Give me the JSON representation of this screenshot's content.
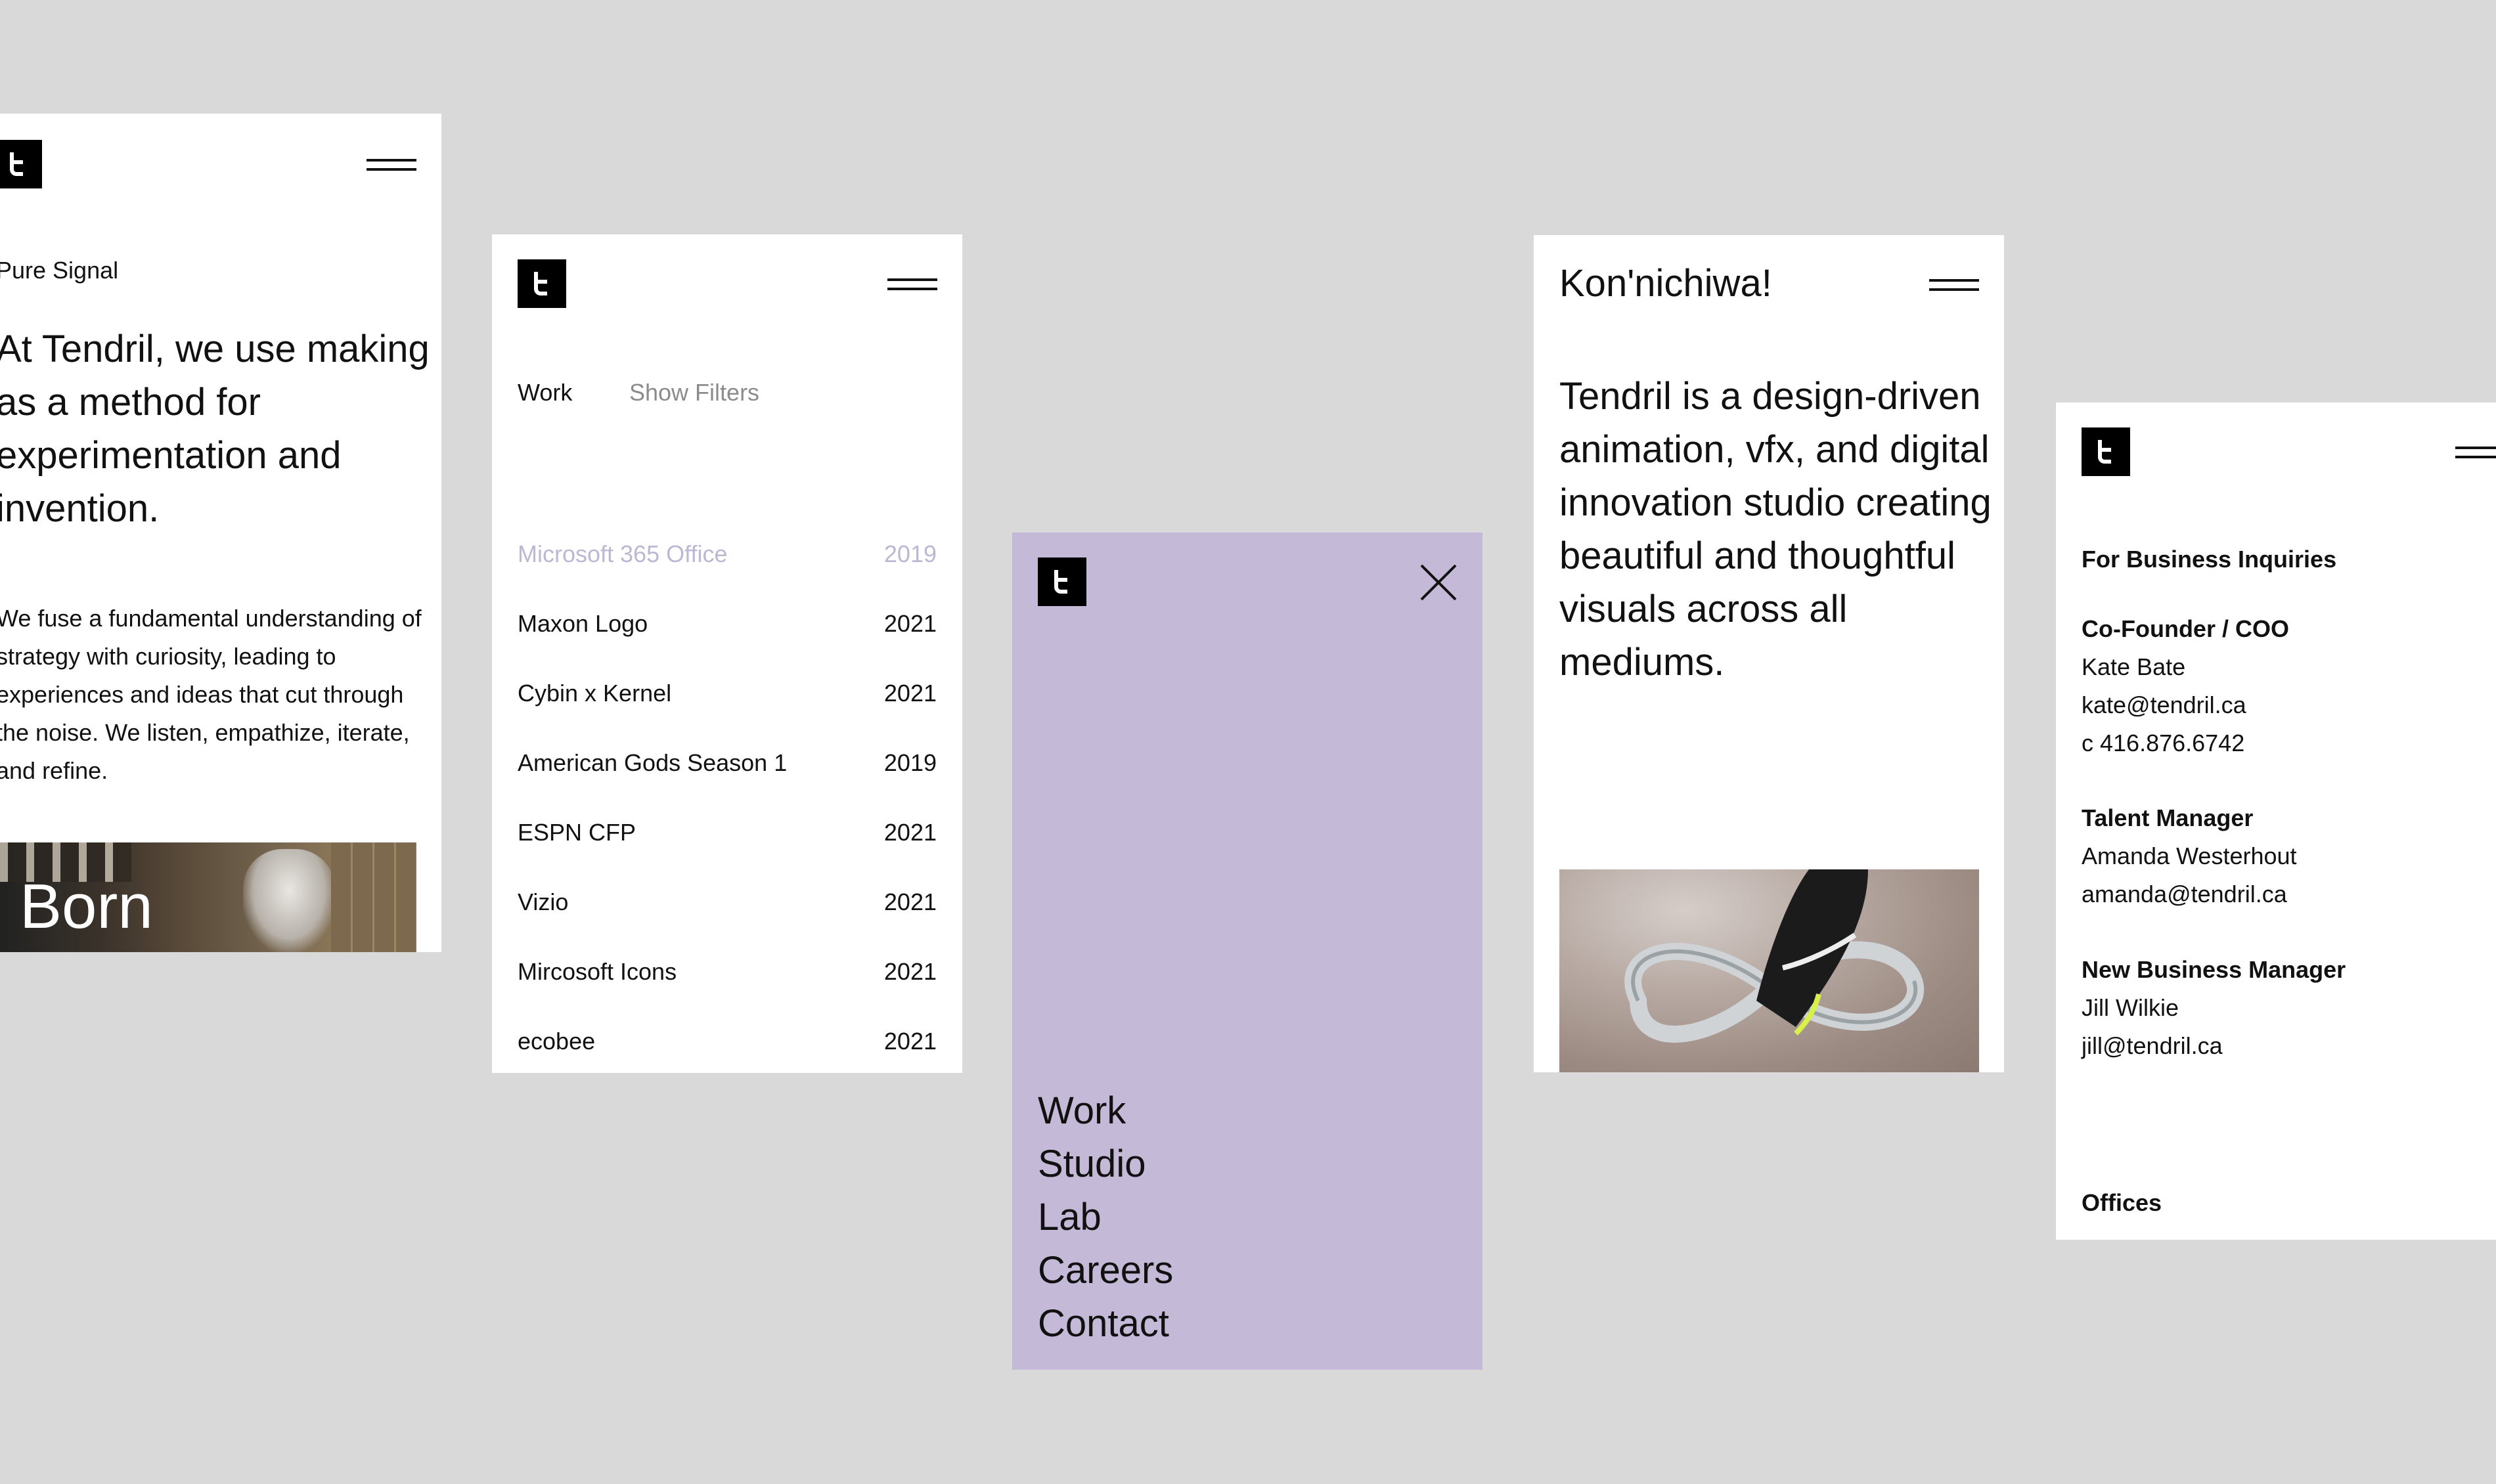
{
  "colors": {
    "canvas": "#d9d9d9",
    "card": "#ffffff",
    "menu_bg": "#c4b9d6",
    "text": "#111111",
    "muted": "#8c8c8c",
    "faded_row": "#bdb7d4"
  },
  "icons": [
    "logo-mark-icon",
    "hamburger-menu-icon",
    "close-icon"
  ],
  "about_card": {
    "eyebrow": "Pure Signal",
    "headline": "At Tendril, we use making as a method for experimentation and invention.",
    "body": "We fuse a fundamental understanding of strategy with curiosity, leading to experiences and ideas that cut through the noise. We listen, empathize, iterate, and refine.",
    "photo_caption": "Born"
  },
  "work_card": {
    "tab_active": "Work",
    "tab_filters": "Show Filters",
    "items": [
      {
        "name": "Microsoft 365 Office",
        "year": "2019"
      },
      {
        "name": "Maxon Logo",
        "year": "2021"
      },
      {
        "name": "Cybin x Kernel",
        "year": "2021"
      },
      {
        "name": "American Gods Season 1",
        "year": "2019"
      },
      {
        "name": "ESPN CFP",
        "year": "2021"
      },
      {
        "name": "Vizio",
        "year": "2021"
      },
      {
        "name": "Mircosoft Icons",
        "year": "2021"
      },
      {
        "name": "ecobee",
        "year": "2021"
      }
    ]
  },
  "menu_card": {
    "nav": [
      "Work",
      "Studio",
      "Lab",
      "Careers",
      "Contact"
    ]
  },
  "hello_card": {
    "greeting": "Kon'nichiwa!",
    "lede": "Tendril is a design-driven animation, vfx, and digital innovation studio creating beautiful and thoughtful visuals across all mediums."
  },
  "contact_card": {
    "heading": "For Business Inquiries",
    "contacts": [
      {
        "role": "Co-Founder / COO",
        "name": "Kate Bate",
        "email": "kate@tendril.ca",
        "phone": "c 416.876.6742"
      },
      {
        "role": "Talent Manager",
        "name": "Amanda Westerhout",
        "email": "amanda@tendril.ca"
      },
      {
        "role": "New Business Manager",
        "name": "Jill Wilkie",
        "email": "jill@tendril.ca"
      }
    ],
    "offices": "Offices"
  }
}
